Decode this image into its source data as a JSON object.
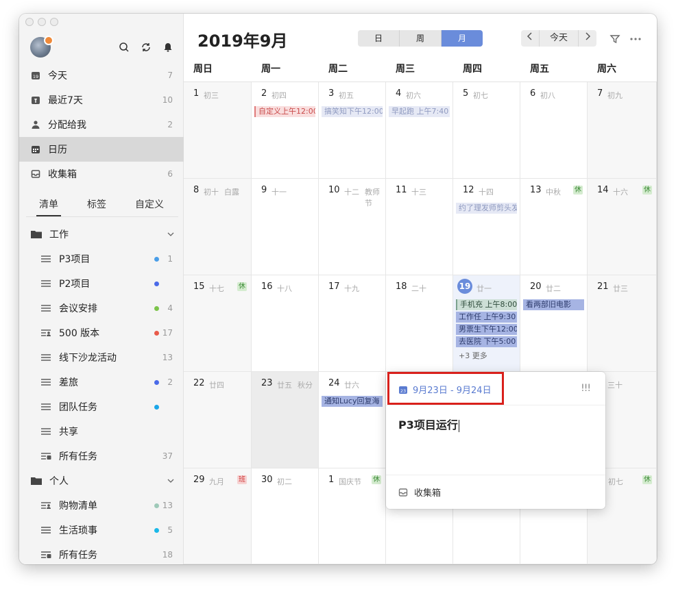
{
  "sidebar": {
    "smart_lists": [
      {
        "label": "今天",
        "count": "7",
        "icon": "calendar-day-icon"
      },
      {
        "label": "最近7天",
        "count": "10",
        "icon": "calendar-week-icon"
      },
      {
        "label": "分配给我",
        "count": "2",
        "icon": "person-icon"
      },
      {
        "label": "日历",
        "count": "",
        "icon": "calendar-icon"
      },
      {
        "label": "收集箱",
        "count": "6",
        "icon": "inbox-icon"
      }
    ],
    "tabs": [
      "清单",
      "标签",
      "自定义"
    ],
    "folders": [
      {
        "label": "工作",
        "items": [
          {
            "label": "P3项目",
            "count": "1",
            "dot": "#4a9ee8",
            "icon": "list-icon"
          },
          {
            "label": "P2项目",
            "count": "",
            "dot": "#4a6ae8",
            "icon": "list-icon"
          },
          {
            "label": "会议安排",
            "count": "4",
            "dot": "#7cc44a",
            "icon": "list-icon"
          },
          {
            "label": "500 版本",
            "count": "17",
            "dot": "#e85a4a",
            "icon": "shared-list-icon"
          },
          {
            "label": "线下沙龙活动",
            "count": "13",
            "dot": "",
            "icon": "list-icon"
          },
          {
            "label": "差旅",
            "count": "2",
            "dot": "#4a6ae8",
            "icon": "list-icon"
          },
          {
            "label": "团队任务",
            "count": "",
            "dot": "#1aa6e8",
            "icon": "list-icon"
          },
          {
            "label": "共享",
            "count": "",
            "dot": "",
            "icon": "list-icon"
          },
          {
            "label": "所有任务",
            "count": "37",
            "dot": "",
            "icon": "all-tasks-icon"
          }
        ]
      },
      {
        "label": "个人",
        "items": [
          {
            "label": "购物清单",
            "count": "13",
            "dot": "#9ec9b8",
            "icon": "shared-list-icon"
          },
          {
            "label": "生活琐事",
            "count": "5",
            "dot": "#1ab8e8",
            "icon": "list-icon"
          },
          {
            "label": "所有任务",
            "count": "18",
            "dot": "",
            "icon": "all-tasks-icon"
          }
        ]
      }
    ]
  },
  "header": {
    "month_title": "2019年9月",
    "view_tabs": [
      "日",
      "周",
      "月"
    ],
    "active_view": "月",
    "today_label": "今天"
  },
  "weekdays": [
    "周日",
    "周一",
    "周二",
    "周三",
    "周四",
    "周五",
    "周六"
  ],
  "calendar": {
    "weeks": [
      [
        {
          "num": "1",
          "lunar": "初三"
        },
        {
          "num": "2",
          "lunar": "初四",
          "events": [
            {
              "text": "自定义上午12:00",
              "style": "red"
            }
          ]
        },
        {
          "num": "3",
          "lunar": "初五",
          "events": [
            {
              "text": "搞笑知下午12:00",
              "style": "faint"
            }
          ]
        },
        {
          "num": "4",
          "lunar": "初六",
          "events": [
            {
              "text": "早起跑 上午7:40",
              "style": "faint"
            }
          ]
        },
        {
          "num": "5",
          "lunar": "初七"
        },
        {
          "num": "6",
          "lunar": "初八"
        },
        {
          "num": "7",
          "lunar": "初九"
        }
      ],
      [
        {
          "num": "8",
          "lunar": "初十",
          "holiday": "白露"
        },
        {
          "num": "9",
          "lunar": "十一"
        },
        {
          "num": "10",
          "lunar": "十二",
          "holiday": "教师节"
        },
        {
          "num": "11",
          "lunar": "十三"
        },
        {
          "num": "12",
          "lunar": "十四",
          "events": [
            {
              "text": "约了理发师剪头发",
              "style": "faint"
            }
          ]
        },
        {
          "num": "13",
          "lunar": "中秋",
          "badge": "休",
          "badge_type": "rest"
        },
        {
          "num": "14",
          "lunar": "十六",
          "badge": "休",
          "badge_type": "rest"
        }
      ],
      [
        {
          "num": "15",
          "lunar": "十七",
          "badge": "休",
          "badge_type": "rest"
        },
        {
          "num": "16",
          "lunar": "十八"
        },
        {
          "num": "17",
          "lunar": "十九"
        },
        {
          "num": "18",
          "lunar": "二十"
        },
        {
          "num": "19",
          "lunar": "廿一",
          "today": true,
          "events": [
            {
              "text": "手机充 上午8:00",
              "style": "green"
            },
            {
              "text": "工作任 上午9:30",
              "style": "solid"
            },
            {
              "text": "男票生下午12:00",
              "style": "solid"
            },
            {
              "text": "去医院 下午5:00",
              "style": "solid"
            }
          ],
          "more": "+3 更多"
        },
        {
          "num": "20",
          "lunar": "廿二",
          "events": [
            {
              "text": "看两部旧电影",
              "style": "solid"
            }
          ]
        },
        {
          "num": "21",
          "lunar": "廿三"
        }
      ],
      [
        {
          "num": "22",
          "lunar": "廿四"
        },
        {
          "num": "23",
          "lunar": "廿五",
          "holiday": "秋分",
          "selected": true
        },
        {
          "num": "24",
          "lunar": "廿六",
          "events": [
            {
              "text": "通知Lucy回复海",
              "style": "solid"
            }
          ]
        },
        {
          "num": "",
          "lunar": ""
        },
        {
          "num": "",
          "lunar": ""
        },
        {
          "num": "",
          "lunar": ""
        },
        {
          "num": "8",
          "lunar": "三十",
          "partial": true
        }
      ],
      [
        {
          "num": "29",
          "lunar": "九月",
          "badge": "班",
          "badge_type": "work"
        },
        {
          "num": "30",
          "lunar": "初二"
        },
        {
          "num": "1",
          "lunar": "国庆节",
          "badge": "休",
          "badge_type": "rest"
        },
        {
          "num": "",
          "lunar": ""
        },
        {
          "num": "",
          "lunar": ""
        },
        {
          "num": "",
          "lunar": ""
        },
        {
          "num": "",
          "lunar": "初七",
          "badge": "休",
          "badge_type": "rest"
        }
      ]
    ]
  },
  "popup": {
    "date_range": "9月23日 - 9月24日",
    "date_icon_day": "23",
    "priority": "!!!",
    "title": "P3项目运行",
    "list": "收集箱"
  },
  "colors": {
    "accent": "#6a8cdb",
    "highlight_box": "#d9201b"
  }
}
